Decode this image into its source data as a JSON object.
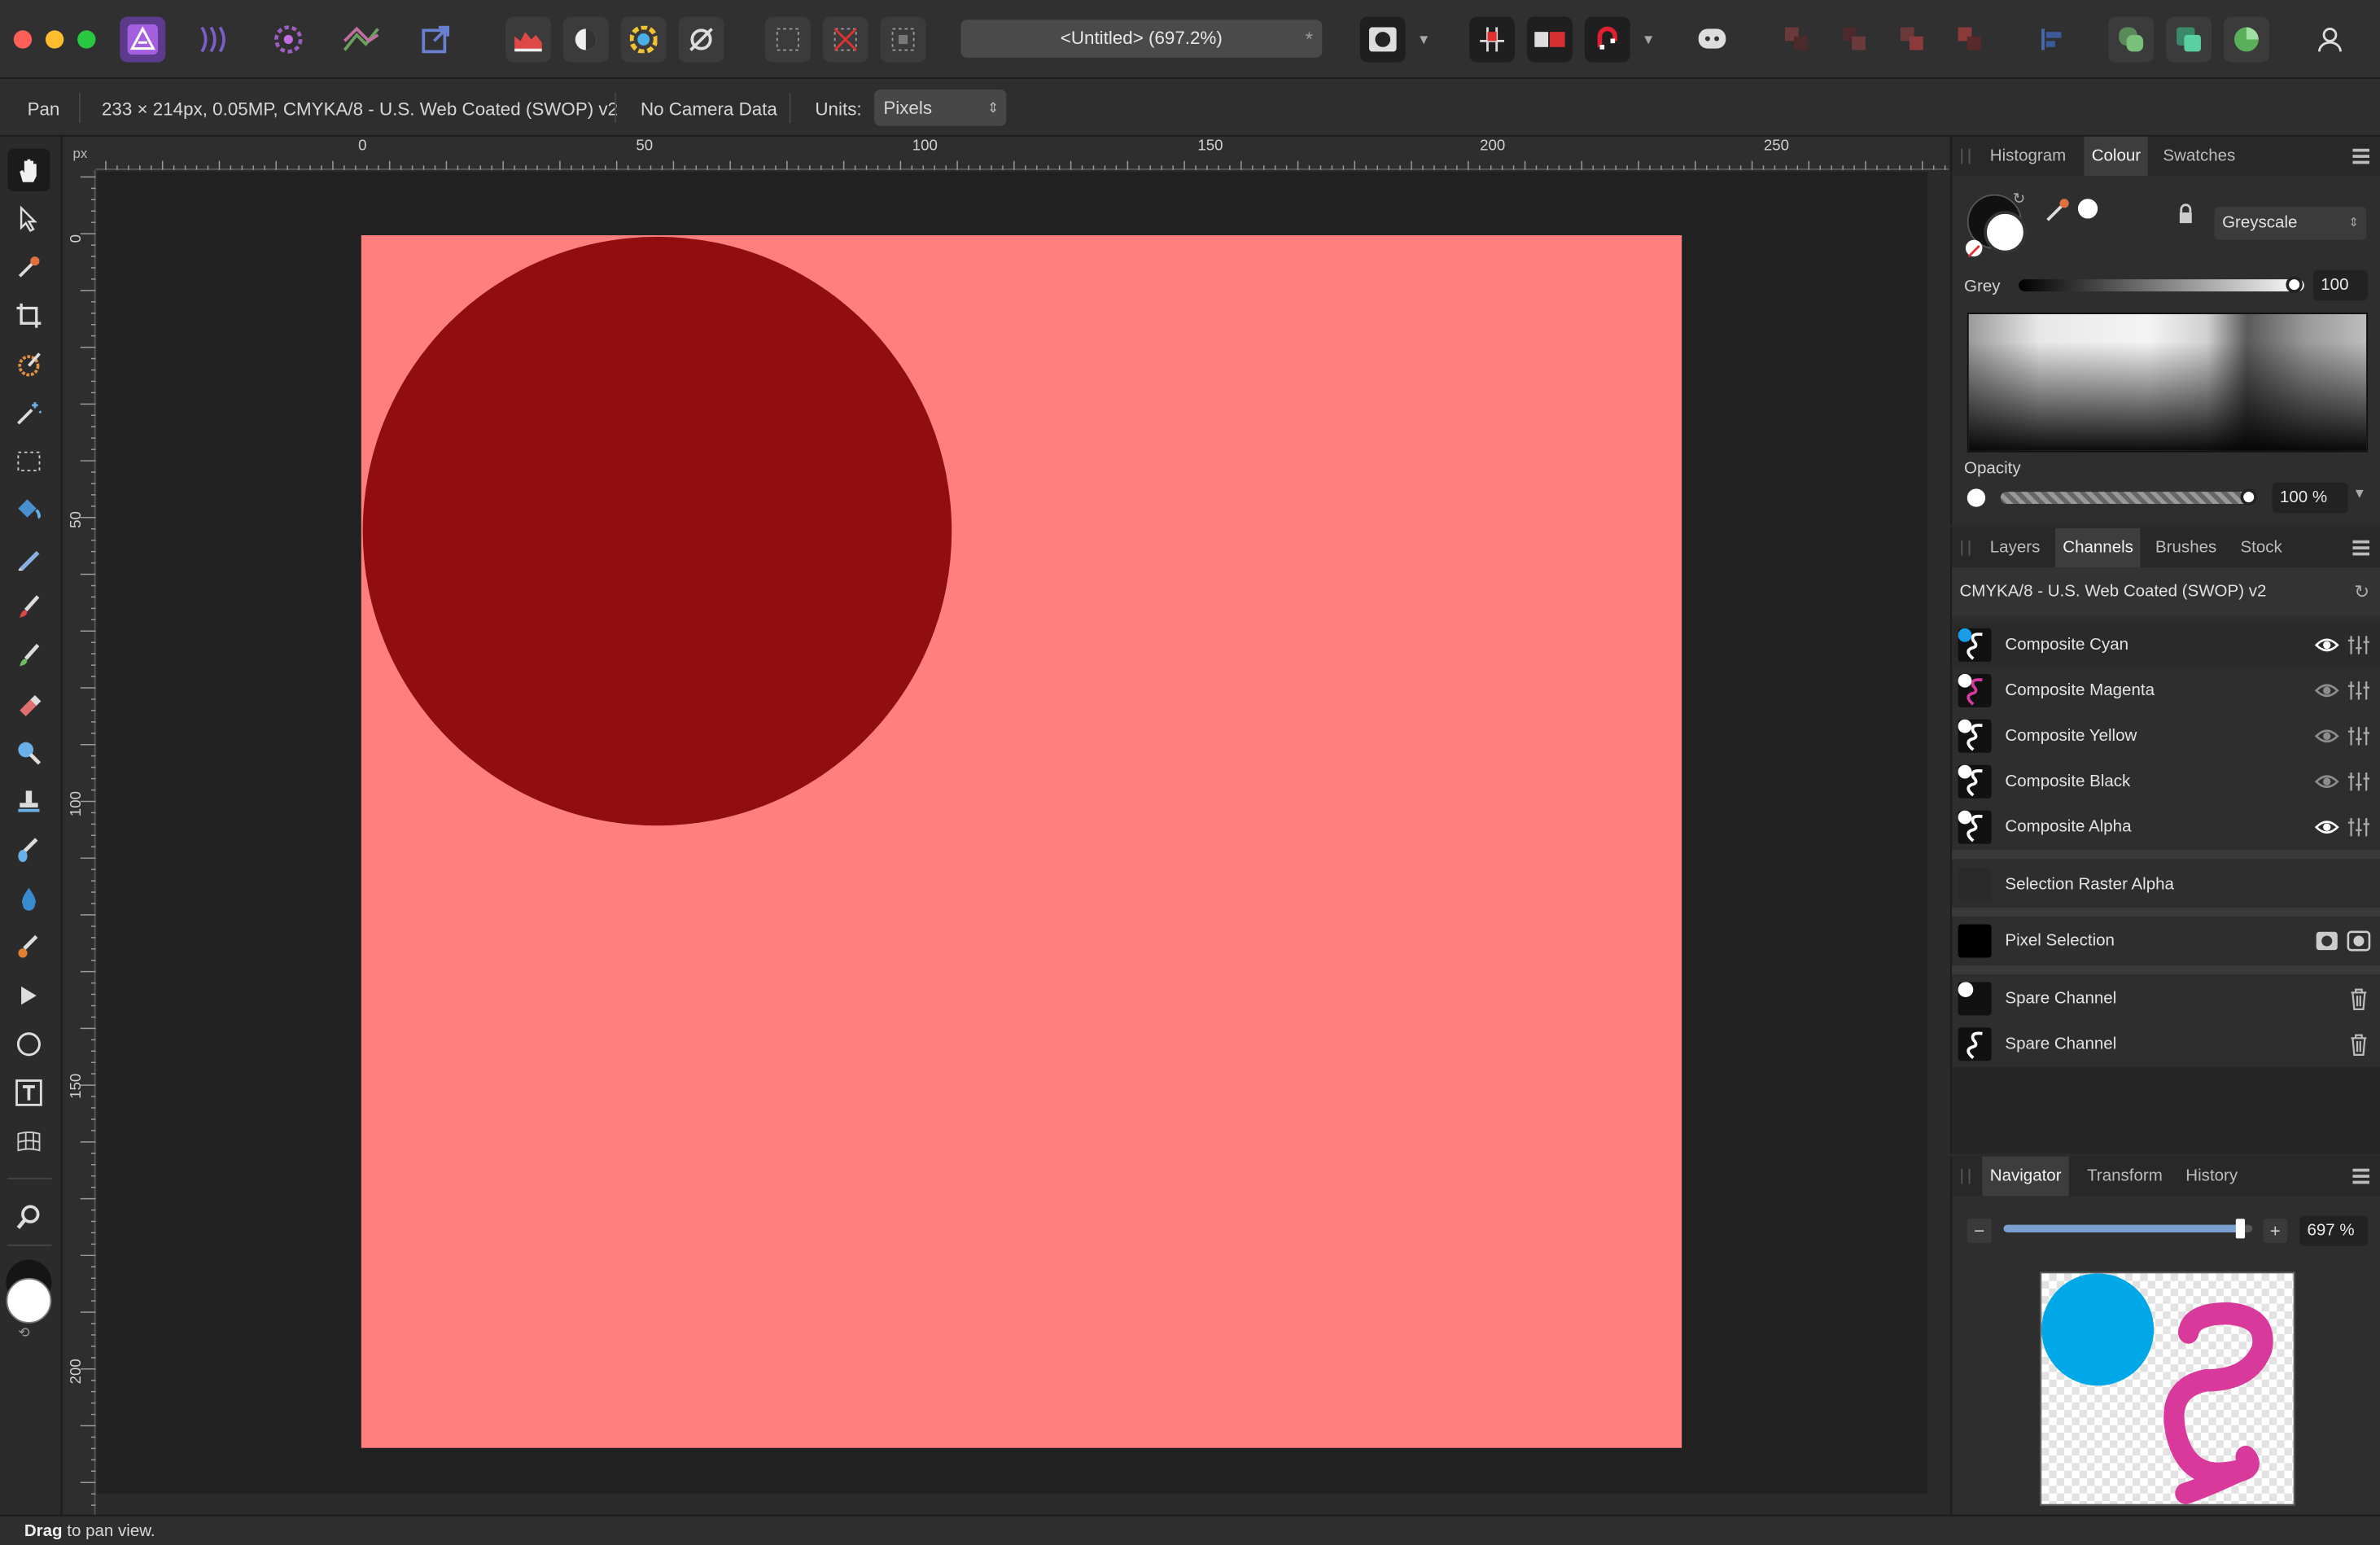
{
  "toolbar": {
    "document_title": "<Untitled> (697.2%)",
    "modified_marker": "*"
  },
  "context_bar": {
    "tool_name": "Pan",
    "doc_info": "233 × 214px, 0.05MP, CMYKA/8 - U.S. Web Coated (SWOP) v2",
    "camera_data": "No Camera Data",
    "units_label": "Units:",
    "units_value": "Pixels"
  },
  "rulers": {
    "unit": "px",
    "h_ticks": [
      "0",
      "50",
      "100",
      "150",
      "200",
      "250"
    ],
    "v_ticks": [
      "0",
      "50",
      "100",
      "150",
      "200"
    ]
  },
  "canvas": {
    "background_color": "#ff7f7f",
    "circle_color": "#900e10",
    "pasteboard_color": "#212121"
  },
  "colour_panel": {
    "tabs": [
      "Histogram",
      "Colour",
      "Swatches"
    ],
    "active_tab": "Colour",
    "mode": "Greyscale",
    "grey_label": "Grey",
    "grey_value": "100",
    "opacity_label": "Opacity",
    "opacity_value": "100 %"
  },
  "channels_panel": {
    "tabs": [
      "Layers",
      "Channels",
      "Brushes",
      "Stock"
    ],
    "active_tab": "Channels",
    "profile": "CMYKA/8 - U.S. Web Coated (SWOP) v2",
    "composite": [
      {
        "name": "Composite Cyan",
        "dot_color": "#1a9de8",
        "squiggle_color": "#ffffff",
        "visible": true
      },
      {
        "name": "Composite Magenta",
        "dot_color": "#ffffff",
        "squiggle_color": "#d63aa0",
        "visible": false
      },
      {
        "name": "Composite Yellow",
        "dot_color": "#ffffff",
        "squiggle_color": "#ffffff",
        "visible": false
      },
      {
        "name": "Composite Black",
        "dot_color": "#ffffff",
        "squiggle_color": "#ffffff",
        "visible": false
      },
      {
        "name": "Composite Alpha",
        "dot_color": "#ffffff",
        "squiggle_color": "#ffffff",
        "visible": true
      }
    ],
    "selection_raster": "Selection Raster Alpha",
    "pixel_selection": "Pixel Selection",
    "spare": [
      "Spare Channel",
      "Spare Channel"
    ]
  },
  "navigator_panel": {
    "tabs": [
      "Navigator",
      "Transform",
      "History"
    ],
    "active_tab": "Navigator",
    "zoom_value": "697 %",
    "zoom_level": 0.95
  },
  "status_bar": {
    "action": "Drag",
    "hint": " to pan view."
  }
}
